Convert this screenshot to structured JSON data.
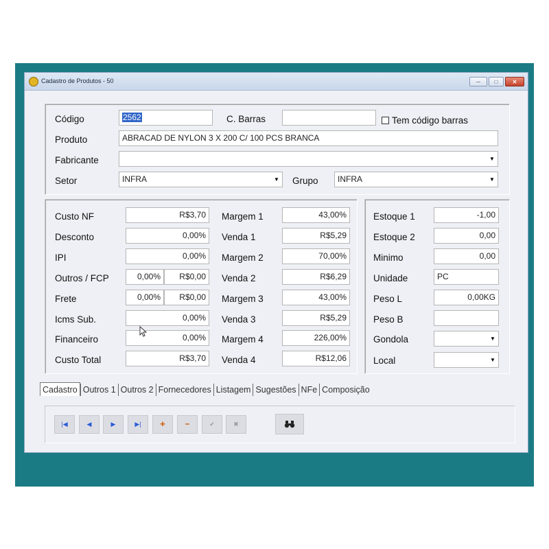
{
  "window": {
    "title": "Cadastro de Produtos - 50",
    "min_label": "─",
    "max_label": "□",
    "close_label": "✕"
  },
  "header": {
    "codigo_label": "Código",
    "codigo_value": "2562",
    "cbarras_label": "C. Barras",
    "cbarras_value": "",
    "tem_codigo_label": "Tem código barras",
    "produto_label": "Produto",
    "produto_value": "ABRACAD DE NYLON 3 X 200 C/ 100 PCS BRANCA",
    "fabricante_label": "Fabricante",
    "fabricante_value": "",
    "setor_label": "Setor",
    "setor_value": "INFRA",
    "grupo_label": "Grupo",
    "grupo_value": "INFRA"
  },
  "costs": {
    "custo_nf_label": "Custo NF",
    "custo_nf_value": "R$3,70",
    "desconto_label": "Desconto",
    "desconto_value": "0,00%",
    "ipi_label": "IPI",
    "ipi_value": "0,00%",
    "outros_label": "Outros / FCP",
    "outros_pct": "0,00%",
    "outros_value": "R$0,00",
    "frete_label": "Frete",
    "frete_pct": "0,00%",
    "frete_value": "R$0,00",
    "icms_label": "Icms Sub.",
    "icms_value": "0,00%",
    "financeiro_label": "Financeiro",
    "financeiro_value": "0,00%",
    "custo_total_label": "Custo Total",
    "custo_total_value": "R$3,70"
  },
  "margins": {
    "margem1_label": "Margem 1",
    "margem1_value": "43,00%",
    "venda1_label": "Venda 1",
    "venda1_value": "R$5,29",
    "margem2_label": "Margem 2",
    "margem2_value": "70,00%",
    "venda2_label": "Venda 2",
    "venda2_value": "R$6,29",
    "margem3_label": "Margem 3",
    "margem3_value": "43,00%",
    "venda3_label": "Venda 3",
    "venda3_value": "R$5,29",
    "margem4_label": "Margem 4",
    "margem4_value": "226,00%",
    "venda4_label": "Venda 4",
    "venda4_value": "R$12,06"
  },
  "stock": {
    "estoque1_label": "Estoque 1",
    "estoque1_value": "-1,00",
    "estoque2_label": "Estoque 2",
    "estoque2_value": "0,00",
    "minimo_label": "Minimo",
    "minimo_value": "0,00",
    "unidade_label": "Unidade",
    "unidade_value": "PC",
    "pesol_label": "Peso L",
    "pesol_value": "0,00KG",
    "pesob_label": "Peso B",
    "pesob_value": "",
    "gondola_label": "Gondola",
    "gondola_value": "",
    "local_label": "Local",
    "local_value": ""
  },
  "tabs": [
    "Cadastro",
    "Outros 1",
    "Outros 2",
    "Fornecedores",
    "Listagem",
    "Sugestões",
    "NFe",
    "Composição"
  ],
  "toolbar": {
    "first_icon": "|◀",
    "prev_icon": "◀",
    "next_icon": "▶",
    "last_icon": "▶|",
    "add_icon": "✚",
    "remove_icon": "━",
    "confirm_icon": "✔",
    "cancel_icon": "✖",
    "search_icon": "🔭"
  },
  "colors": {
    "desktop": "#1b7b84",
    "accent_orange": "#d2691e",
    "nav_blue": "#2a5bd7"
  }
}
